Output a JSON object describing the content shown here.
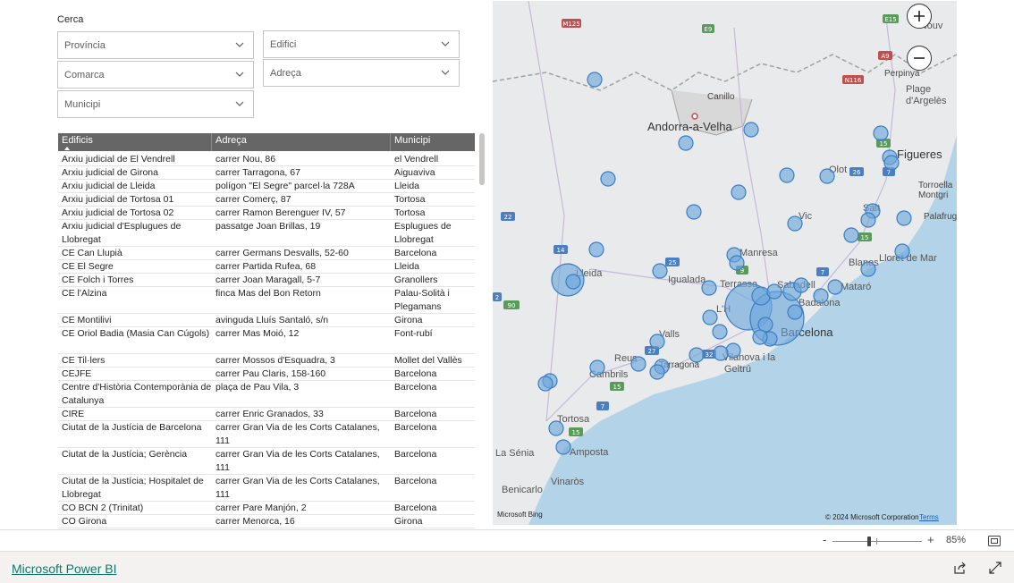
{
  "search": {
    "label": "Cerca",
    "slicers": {
      "provincia": "Província",
      "comarca": "Comarca",
      "municipi": "Municipi",
      "edifici": "Edifici",
      "adreca": "Adreça"
    }
  },
  "table": {
    "columns": [
      "Edificis",
      "Adreça",
      "Municipi"
    ],
    "rows": [
      [
        "Arxiu judicial de El Vendrell",
        "carrer Nou, 86",
        "el Vendrell"
      ],
      [
        "Arxiu judicial de Girona",
        "carrer Tarragona, 67",
        "Aiguaviva"
      ],
      [
        "Arxiu judicial de Lleida",
        "polígon \"El Segre\" parcel·la 728A",
        "Lleida"
      ],
      [
        "Arxiu judicial de Tortosa 01",
        "carrer Comerç, 87",
        "Tortosa"
      ],
      [
        "Arxiu judicial de Tortosa 02",
        "carrer Ramon Berenguer IV, 57",
        "Tortosa"
      ],
      [
        "Arxiu judicial d'Esplugues de Llobregat",
        "passatge Joan Brillas, 19",
        "Esplugues de Llobregat"
      ],
      [
        "CE Can Llupià",
        "carrer Germans Desvalls, 52-60",
        "Barcelona"
      ],
      [
        "CE El Segre",
        "carrer Partida Rufea, 68",
        "Lleida"
      ],
      [
        "CE Folch i Torres",
        "carrer Joan Maragall, 5-7",
        "Granollers"
      ],
      [
        "CE l'Alzina",
        "finca Mas del Bon Retorn",
        "Palau-Solità i Plegamans"
      ],
      [
        "CE Montilivi",
        "avinguda Lluís Santaló, s/n",
        "Girona"
      ],
      [
        "CE Oriol Badia (Masia Can Cúgols)",
        "carrer Mas Moió, 12",
        "Font-rubí"
      ],
      [
        "CE Til·lers",
        "carrer Mossos d'Esquadra, 3",
        "Mollet del Vallès"
      ],
      [
        "CEJFE",
        "carrer Pau Claris, 158-160",
        "Barcelona"
      ],
      [
        "Centre d'Història Contemporània de Catalunya",
        "plaça de Pau Vila, 3",
        "Barcelona"
      ],
      [
        "CIRE",
        "carrer Enric Granados, 33",
        "Barcelona"
      ],
      [
        "Ciutat de la Justícia de Barcelona",
        "carrer Gran Via de les Corts Catalanes, 111",
        "Barcelona"
      ],
      [
        "Ciutat de la Justícia; Gerència",
        "carrer Gran Via de les Corts Catalanes, 111",
        "Barcelona"
      ],
      [
        "Ciutat de la Justícia; Hospitalet de Llobregat",
        "carrer Gran Via de les Corts Catalanes, 111",
        "Barcelona"
      ],
      [
        "CO BCN 2 (Trinitat)",
        "carrer Pare Manjón, 2",
        "Barcelona"
      ],
      [
        "CO Girona",
        "carrer Menorca, 16",
        "Girona"
      ]
    ]
  },
  "map": {
    "places": {
      "andorra": "Andorra-a-Velha",
      "canillo": "Canillo",
      "figueres": "Figueres",
      "perpinya": "Perpinya",
      "plage": "Plage",
      "dargeles": "d'Argelès",
      "olot": "Olot",
      "vic": "Vic",
      "salt": "Salt",
      "torroella": "Torroella",
      "montgri": "Montgri",
      "palafrugell": "Palafrug",
      "blanes": "Blanes",
      "lloret": "Lloret de Mar",
      "manresa": "Manresa",
      "igualada": "Igualada",
      "terrassa": "Terrassa",
      "sabadell": "Sabadell",
      "mataro": "Mataró",
      "badalona": "Badalona",
      "barcelona": "Barcelona",
      "lleida": "Lleida",
      "valls": "Valls",
      "reus": "Reus",
      "tarragona": "Tarragona",
      "vilanova": "Vilanova i la",
      "geltru": "Geltrú",
      "cambrils": "Cambrils",
      "tortosa": "Tortosa",
      "amposta": "Amposta",
      "senia": "La Sénia",
      "vinaros": "Vinaròs",
      "benicarlo": "Benicarlo",
      "llob": "L'H",
      "llbadge": "9",
      "tnou": "-Nouv"
    },
    "road_badges": [
      "M125",
      "E9",
      "E15",
      "A9",
      "N116",
      "15",
      "26",
      "7",
      "22",
      "14",
      "25",
      "9",
      "2",
      "90",
      "27",
      "32",
      "15",
      "7",
      "15",
      "7",
      "15"
    ],
    "copyright": "© 2024 Microsoft Corporation",
    "terms": "Terms",
    "bing": "Microsoft Bing",
    "zoom_in": "+",
    "zoom_out": "−"
  },
  "zoom": {
    "minus": "-",
    "plus": "+",
    "value": "85%"
  },
  "footer": {
    "link": "Microsoft Power BI"
  },
  "colors": {
    "bubble_fill": "#6fa8dc",
    "bubble_stroke": "#3b7dc4",
    "table_header": "#666666",
    "water": "#b3d4e8",
    "link": "#117865"
  }
}
